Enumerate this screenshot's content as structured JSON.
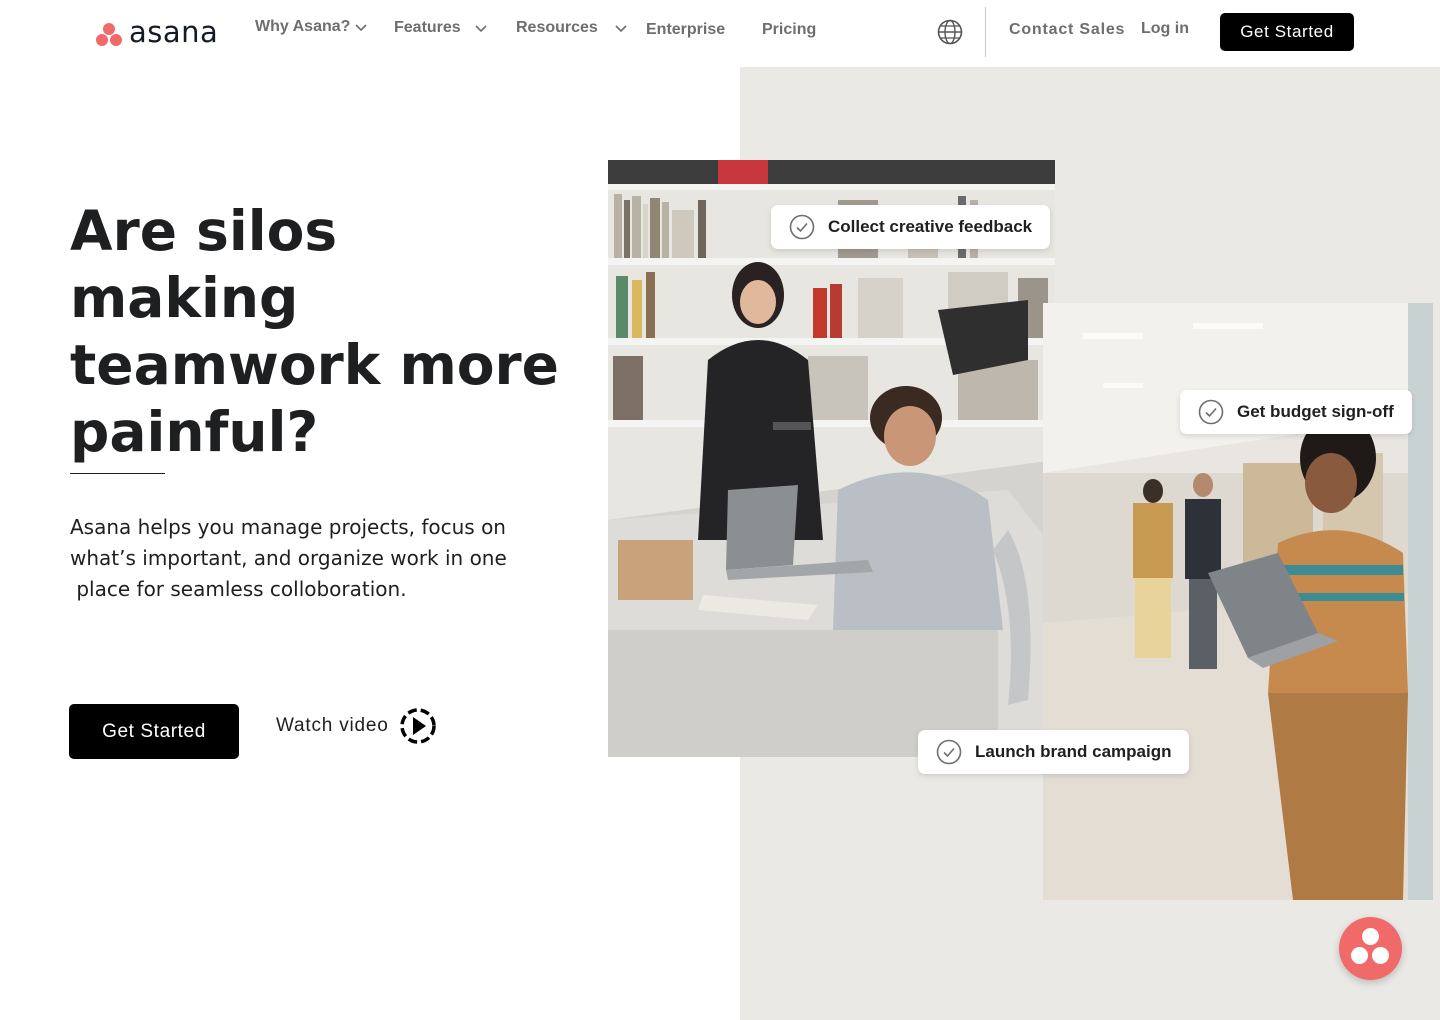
{
  "header": {
    "logo_text": "asana",
    "nav": [
      {
        "label": "Why Asana?",
        "has_dropdown": true
      },
      {
        "label": "Features",
        "has_dropdown": true
      },
      {
        "label": "Resources",
        "has_dropdown": true
      },
      {
        "label": "Enterprise",
        "has_dropdown": false
      },
      {
        "label": "Pricing",
        "has_dropdown": false
      }
    ],
    "globe_icon": "globe-icon",
    "contact_sales": "Contact Sales",
    "login": "Log in",
    "get_started": "Get Started"
  },
  "hero": {
    "headline": "Are silos making teamwork more painful?",
    "description": "Asana helps you manage projects, focus on what’s important, and organize work in one\n place for seamless colloboration.",
    "cta_label": "Get Started",
    "watch_video_label": "Watch video",
    "play_icon": "play-circle-icon"
  },
  "tasks": [
    {
      "label": "Collect creative feedback"
    },
    {
      "label": "Get budget sign-off"
    },
    {
      "label": "Launch brand campaign"
    }
  ],
  "colors": {
    "brand_coral": "#f06a6a",
    "cta_black": "#000000",
    "panel_gray": "#eae9e6",
    "nav_gray": "#6d6e6f"
  }
}
